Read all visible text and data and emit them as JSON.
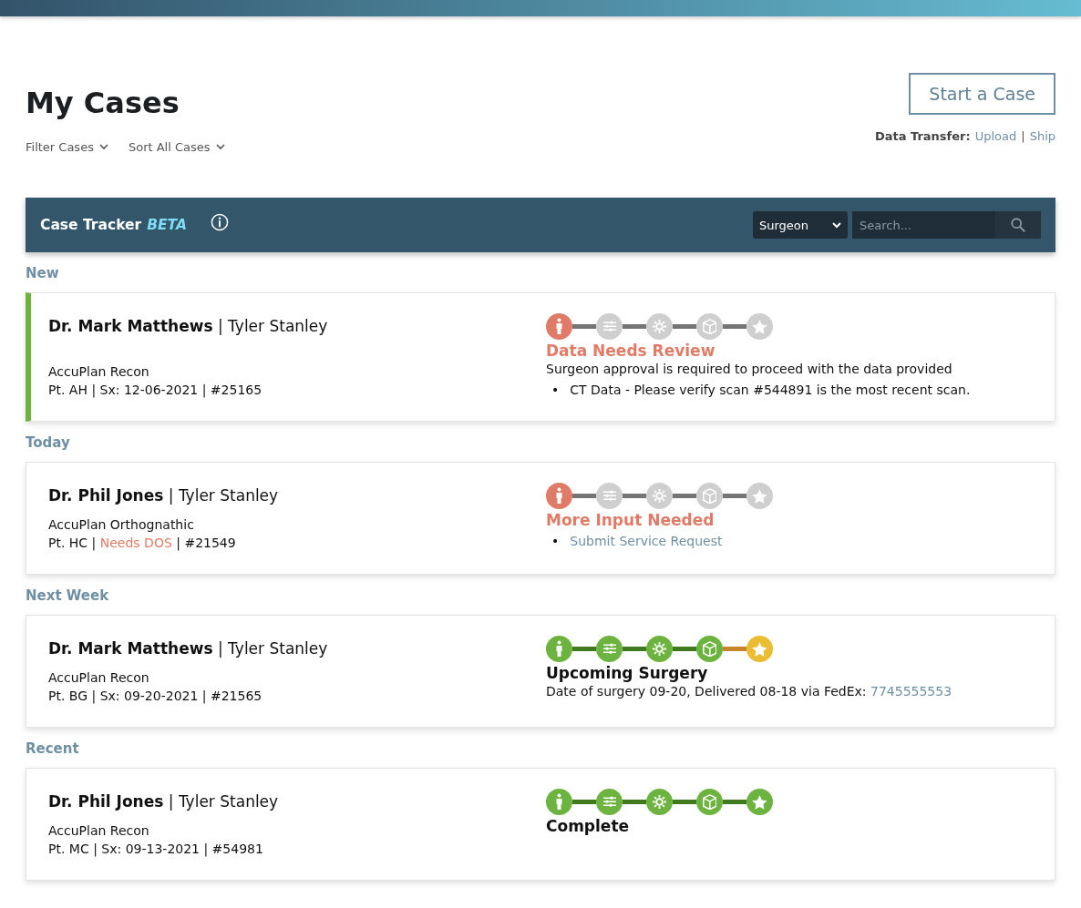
{
  "page": {
    "title": "My Cases",
    "filters": [
      {
        "label": "Filter Cases"
      },
      {
        "label": "Sort All Cases"
      }
    ],
    "start_button": "Start a Case",
    "data_transfer": {
      "label": "Data Transfer:",
      "separator": "|",
      "links": [
        "Upload",
        "Ship"
      ]
    }
  },
  "tracker": {
    "title": "Case Tracker",
    "badge": "BETA",
    "select_value": "Surgeon",
    "search_placeholder": "Search..."
  },
  "sections": [
    {
      "heading": "New",
      "cases": [
        {
          "highlighted": true,
          "doctor": "**Dr. Mark Matthews** | Tyler Stanley",
          "product": "AccuPlan Recon",
          "patient": [
            {
              "kind": "plain",
              "text": "Pt. AH | Sx: 12-06-2021 | #25165"
            }
          ],
          "steps": [
            {
              "kind": "alert"
            },
            {
              "kind": "pending"
            },
            {
              "kind": "pending"
            },
            {
              "kind": "pending"
            },
            {
              "kind": "pending"
            }
          ],
          "status": {
            "text": "Data Needs Review",
            "kind": "alert"
          },
          "detail": [
            {
              "kind": "plain",
              "text": "Surgeon approval is required to proceed with the data provided"
            }
          ],
          "bullets": [
            {
              "kind": "plain",
              "marker": "•",
              "text": "CT Data - Please verify scan #544891 is the most recent scan."
            }
          ]
        }
      ]
    },
    {
      "heading": "Today",
      "cases": [
        {
          "highlighted": false,
          "doctor": "**Dr. Phil Jones** | Tyler Stanley",
          "product": "AccuPlan Orthognathic",
          "patient": [
            {
              "kind": "plain",
              "text": "Pt. HC | "
            },
            {
              "kind": "warning",
              "text": "Needs DOS"
            },
            {
              "kind": "plain",
              "text": " | #21549"
            }
          ],
          "steps": [
            {
              "kind": "alert"
            },
            {
              "kind": "pending"
            },
            {
              "kind": "pending"
            },
            {
              "kind": "pending"
            },
            {
              "kind": "pending"
            }
          ],
          "status": {
            "text": "More Input Needed",
            "kind": "alert"
          },
          "bullets": [
            {
              "kind": "link",
              "marker": "•",
              "text": "Submit Service Request"
            }
          ]
        }
      ]
    },
    {
      "heading": "Next Week",
      "cases": [
        {
          "highlighted": false,
          "doctor": "**Dr. Mark Matthews** | Tyler Stanley",
          "product": "AccuPlan Recon",
          "patient": [
            {
              "kind": "plain",
              "text": "Pt. BG | Sx: 09-20-2021 | #21565"
            }
          ],
          "steps": [
            {
              "kind": "done"
            },
            {
              "kind": "done"
            },
            {
              "kind": "done"
            },
            {
              "kind": "done"
            },
            {
              "kind": "upcoming"
            }
          ],
          "status": {
            "text": "Upcoming Surgery",
            "kind": "normal"
          },
          "detail": [
            {
              "kind": "plain",
              "text": "Date of surgery 09-20, Delivered 08-18 via FedEx: "
            },
            {
              "kind": "link",
              "text": "7745555553"
            }
          ]
        }
      ]
    },
    {
      "heading": "Recent",
      "cases": [
        {
          "highlighted": false,
          "doctor": "**Dr. Phil Jones** | Tyler Stanley",
          "product": "AccuPlan Recon",
          "patient": [
            {
              "kind": "plain",
              "text": "Pt. MC | Sx: 09-13-2021 | #54981"
            }
          ],
          "steps": [
            {
              "kind": "done"
            },
            {
              "kind": "done"
            },
            {
              "kind": "done"
            },
            {
              "kind": "done"
            },
            {
              "kind": "done"
            }
          ],
          "status": {
            "text": "Complete",
            "kind": "normal"
          }
        }
      ]
    }
  ]
}
